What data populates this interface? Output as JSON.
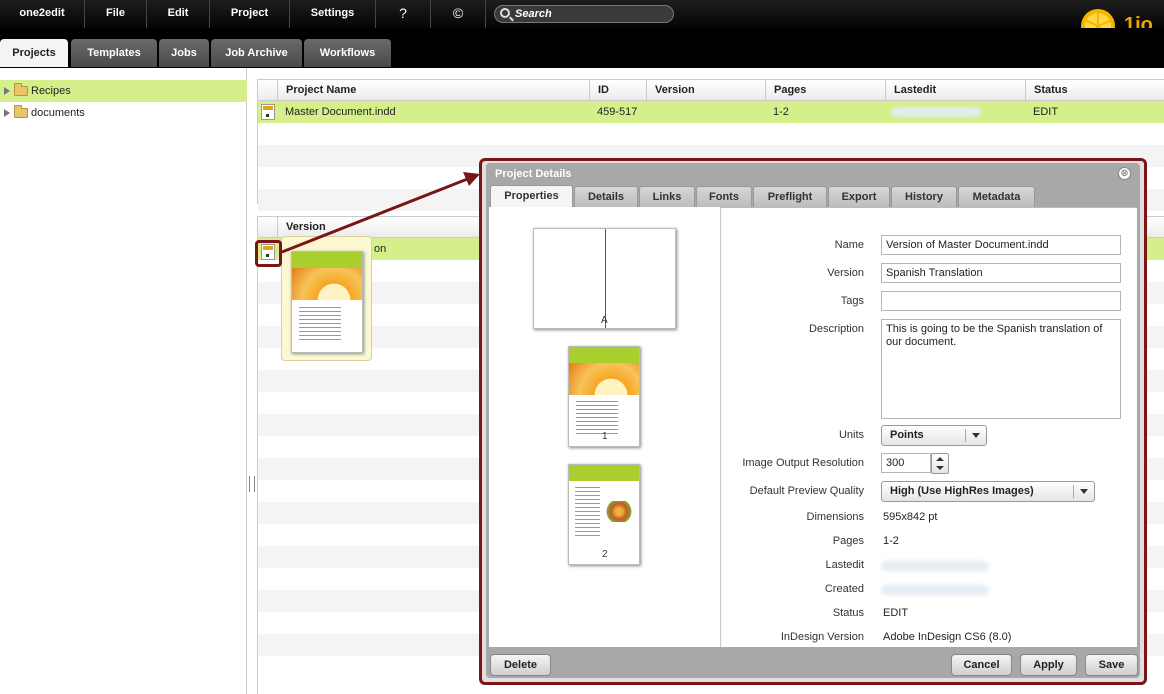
{
  "menu": {
    "app": "one2edit",
    "file": "File",
    "edit": "Edit",
    "project": "Project",
    "settings": "Settings",
    "help": "?",
    "copyright": "©",
    "search_placeholder": "Search"
  },
  "logo": {
    "text": "1io"
  },
  "tabs": [
    "Projects",
    "Templates",
    "Jobs",
    "Job Archive",
    "Workflows"
  ],
  "tree": [
    {
      "label": "Recipes",
      "selected": true
    },
    {
      "label": "documents",
      "selected": false
    }
  ],
  "grid": {
    "headers": [
      "Project Name",
      "ID",
      "Version",
      "Pages",
      "Lastedit",
      "Status"
    ],
    "rows": [
      {
        "name": "Master Document.indd",
        "id": "459-517",
        "version": "",
        "pages": "1-2",
        "status": "EDIT"
      }
    ]
  },
  "versions": {
    "header": "Version",
    "row_partial": "on"
  },
  "dialog": {
    "title": "Project Details",
    "close": "⊗",
    "tabs": [
      "Properties",
      "Details",
      "Links",
      "Fonts",
      "Preflight",
      "Export",
      "History",
      "Metadata"
    ],
    "thumb_pages": [
      "A",
      "1",
      "2"
    ],
    "labels": {
      "name": "Name",
      "version": "Version",
      "tags": "Tags",
      "description": "Description",
      "units": "Units",
      "resolution": "Image Output Resolution",
      "quality": "Default Preview Quality",
      "dimensions": "Dimensions",
      "pages": "Pages",
      "lastedit": "Lastedit",
      "created": "Created",
      "status": "Status",
      "indesign": "InDesign Version"
    },
    "values": {
      "name": "Version of Master Document.indd",
      "version": "Spanish Translation",
      "tags": "",
      "description": "This is going to be the Spanish translation of our document.",
      "units": "Points",
      "resolution": "300",
      "quality": "High (Use HighRes Images)",
      "dimensions": "595x842 pt",
      "pages": "1-2",
      "status": "EDIT",
      "indesign": "Adobe InDesign CS6 (8.0)"
    },
    "buttons": {
      "delete": "Delete",
      "cancel": "Cancel",
      "apply": "Apply",
      "save": "Save"
    }
  },
  "colors": {
    "selection": "#d5f08a",
    "callout": "#7a1616",
    "menubar": "#111111"
  }
}
